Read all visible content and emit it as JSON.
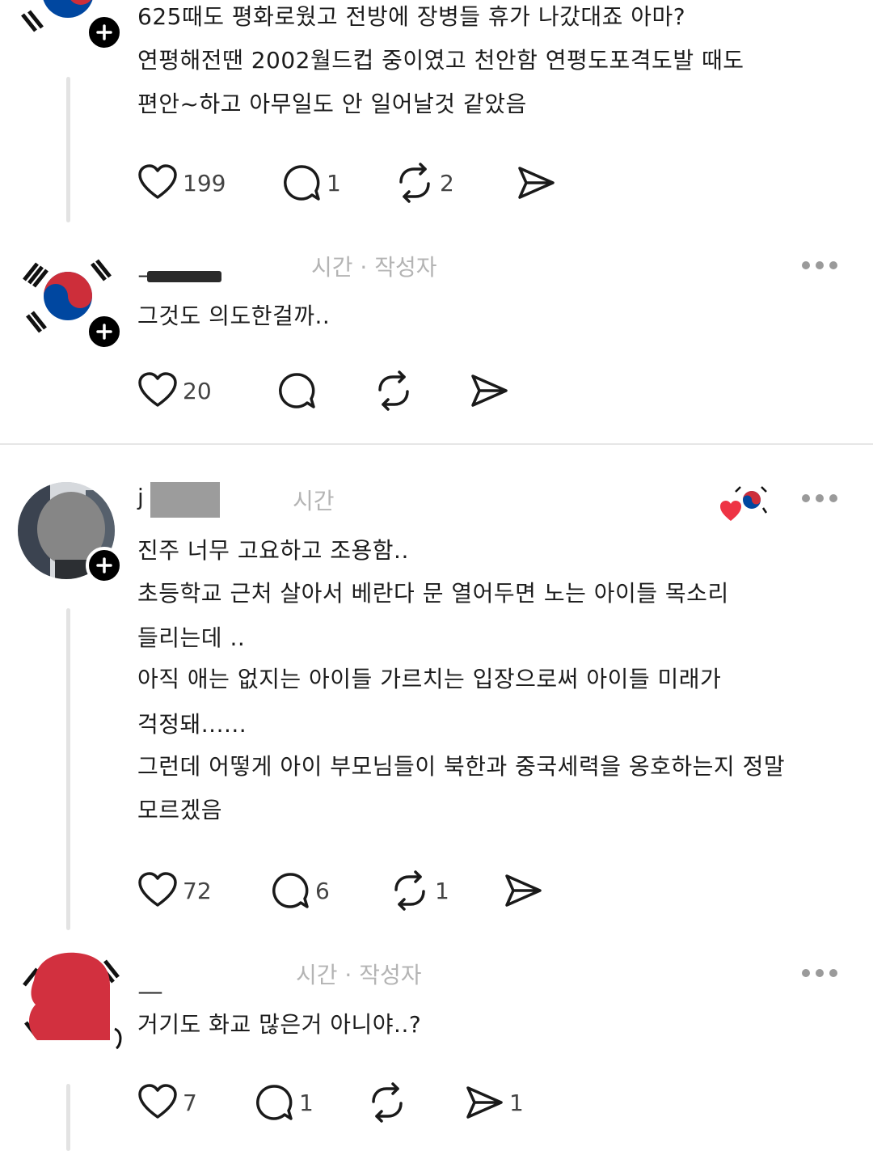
{
  "posts": [
    {
      "lines": [
        "625때도 평화로웠고 전방에 장병들 휴가 나갔대죠 아마?",
        "연평해전땐 2002월드컵 중이였고 천안함 연평도포격도발 때도",
        "편안~하고 아무일도 안 일어날것 같았음"
      ],
      "likes": "199",
      "replies": "1",
      "reposts": "2",
      "shares": ""
    },
    {
      "username": "_",
      "meta": "시간 · 작성자",
      "lines": [
        "그것도 의도한걸까.."
      ],
      "likes": "20",
      "replies": "",
      "reposts": "",
      "shares": ""
    },
    {
      "username": "j",
      "meta": "시간",
      "lines": [
        "진주 너무 고요하고 조용함..",
        "초등학교 근처 살아서 베란다 문 열어두면 노는 아이들 목소리",
        "들리는데 ..",
        "아직 애는 없지는 아이들 가르치는 입장으로써 아이들 미래가",
        "걱정돼......",
        "그런데 어떻게 아이 부모님들이 북한과 중국세력을 옹호하는지 정말",
        "모르겠음"
      ],
      "likes": "72",
      "replies": "6",
      "reposts": "1",
      "shares": ""
    },
    {
      "username": "__",
      "meta": "시간 · 작성자",
      "lines": [
        "거기도 화교 많은거 아니야..?"
      ],
      "likes": "7",
      "replies": "1",
      "reposts": "",
      "shares": "1"
    }
  ],
  "icons": {
    "like": "heart-icon",
    "reply": "comment-icon",
    "repost": "repost-icon",
    "share": "send-icon",
    "more": "more-icon",
    "follow": "plus-icon"
  },
  "colors": {
    "flag_red": "#cd2e3a",
    "flag_blue": "#0047a0",
    "thread_line": "#e3e3e3",
    "meta_text": "#b4b4b4"
  }
}
